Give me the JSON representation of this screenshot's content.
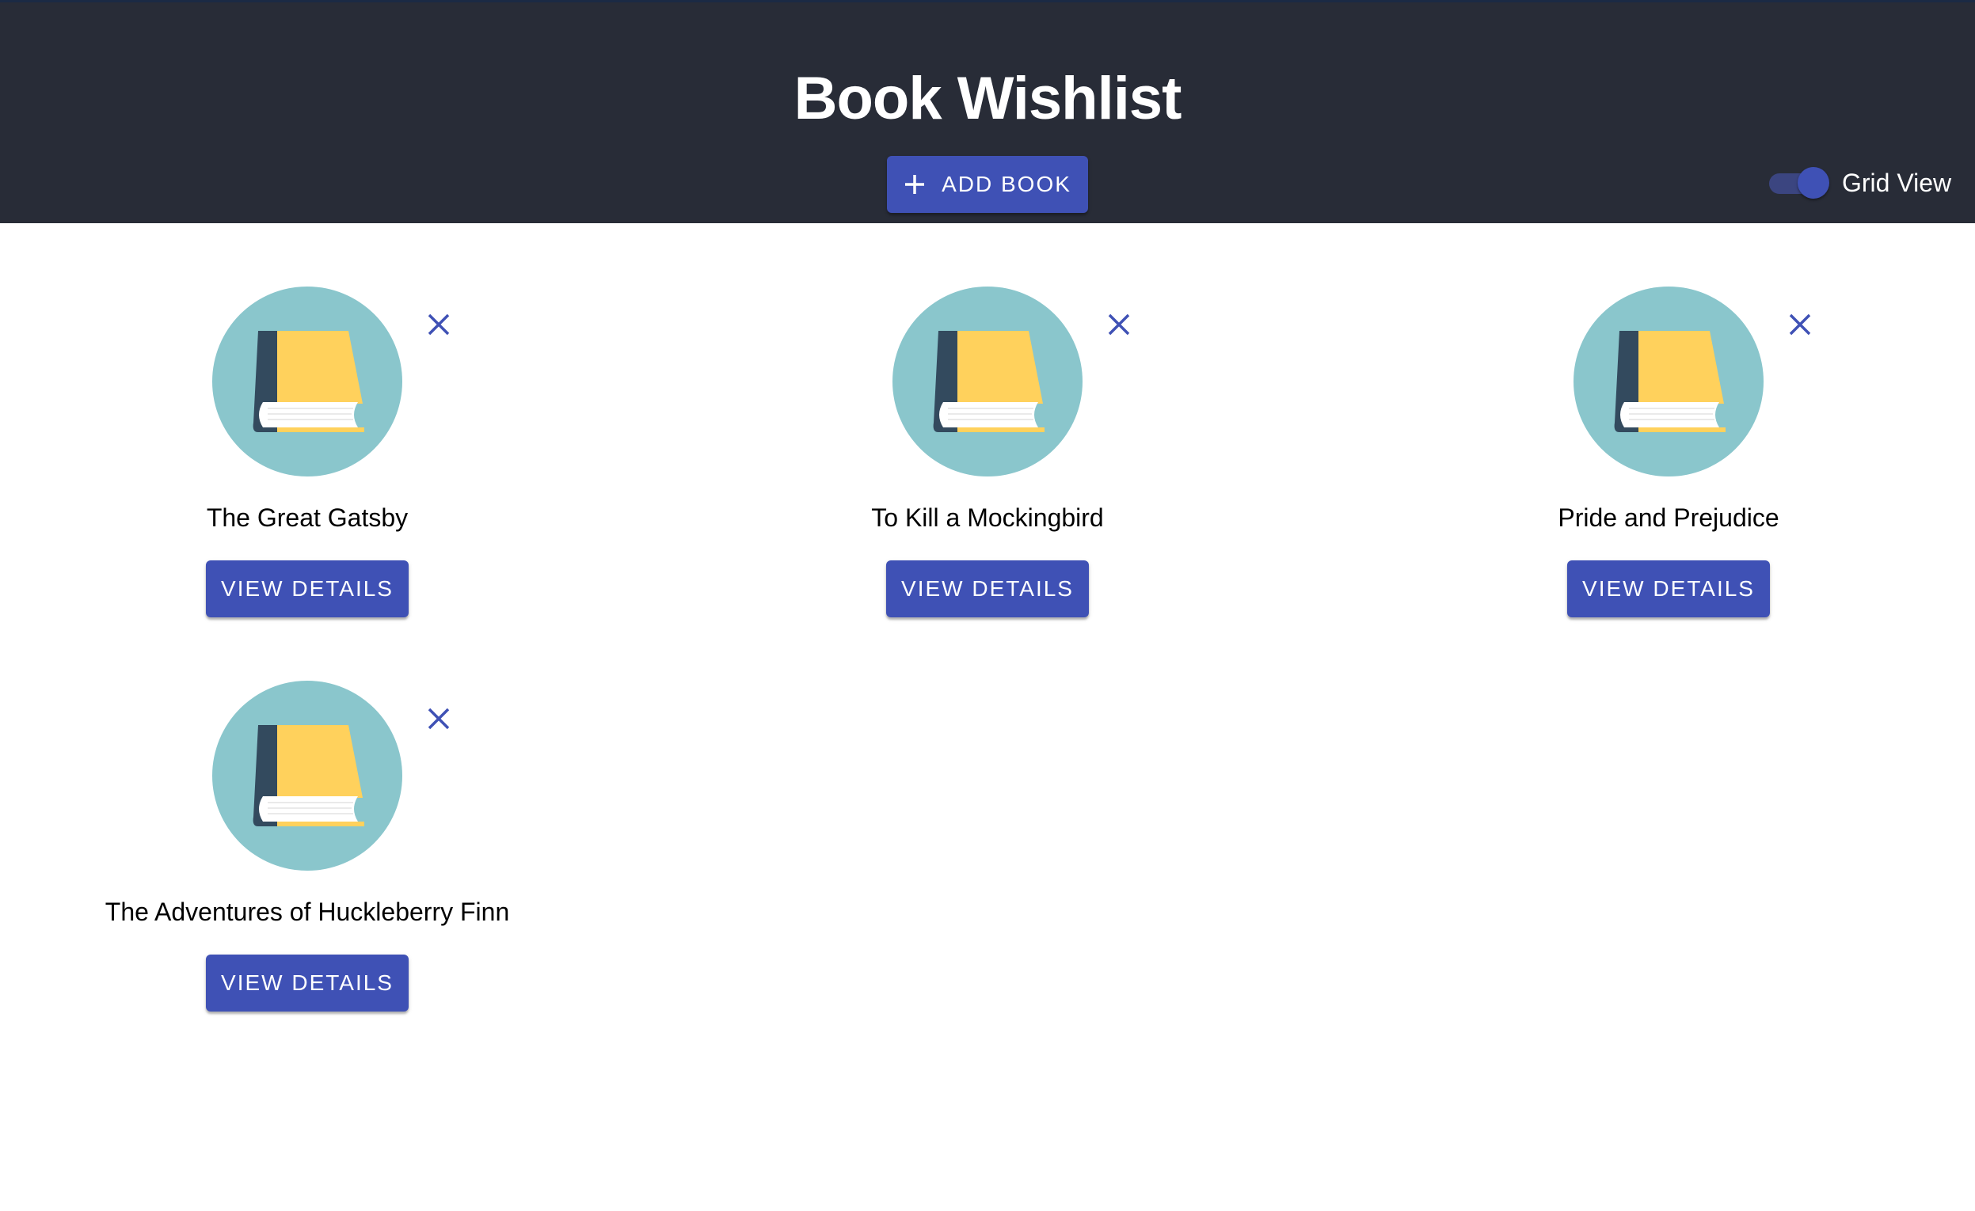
{
  "header": {
    "title": "Book Wishlist",
    "add_button_label": "Add Book",
    "view_toggle": {
      "label": "Grid View",
      "checked": true
    }
  },
  "books": [
    {
      "title": "The Great Gatsby",
      "details_label": "View Details"
    },
    {
      "title": "To Kill a Mockingbird",
      "details_label": "View Details"
    },
    {
      "title": "Pride and Prejudice",
      "details_label": "View Details"
    },
    {
      "title": "The Adventures of Huckleberry Finn",
      "details_label": "View Details"
    }
  ],
  "icons": {
    "add": "plus-icon",
    "remove": "close-icon",
    "book": "book-icon"
  },
  "colors": {
    "header_bg": "#282c37",
    "primary": "#3f51b5",
    "avatar_bg": "#8ac6cc",
    "book_cover": "#ffd15c",
    "book_spine": "#334a5e"
  }
}
